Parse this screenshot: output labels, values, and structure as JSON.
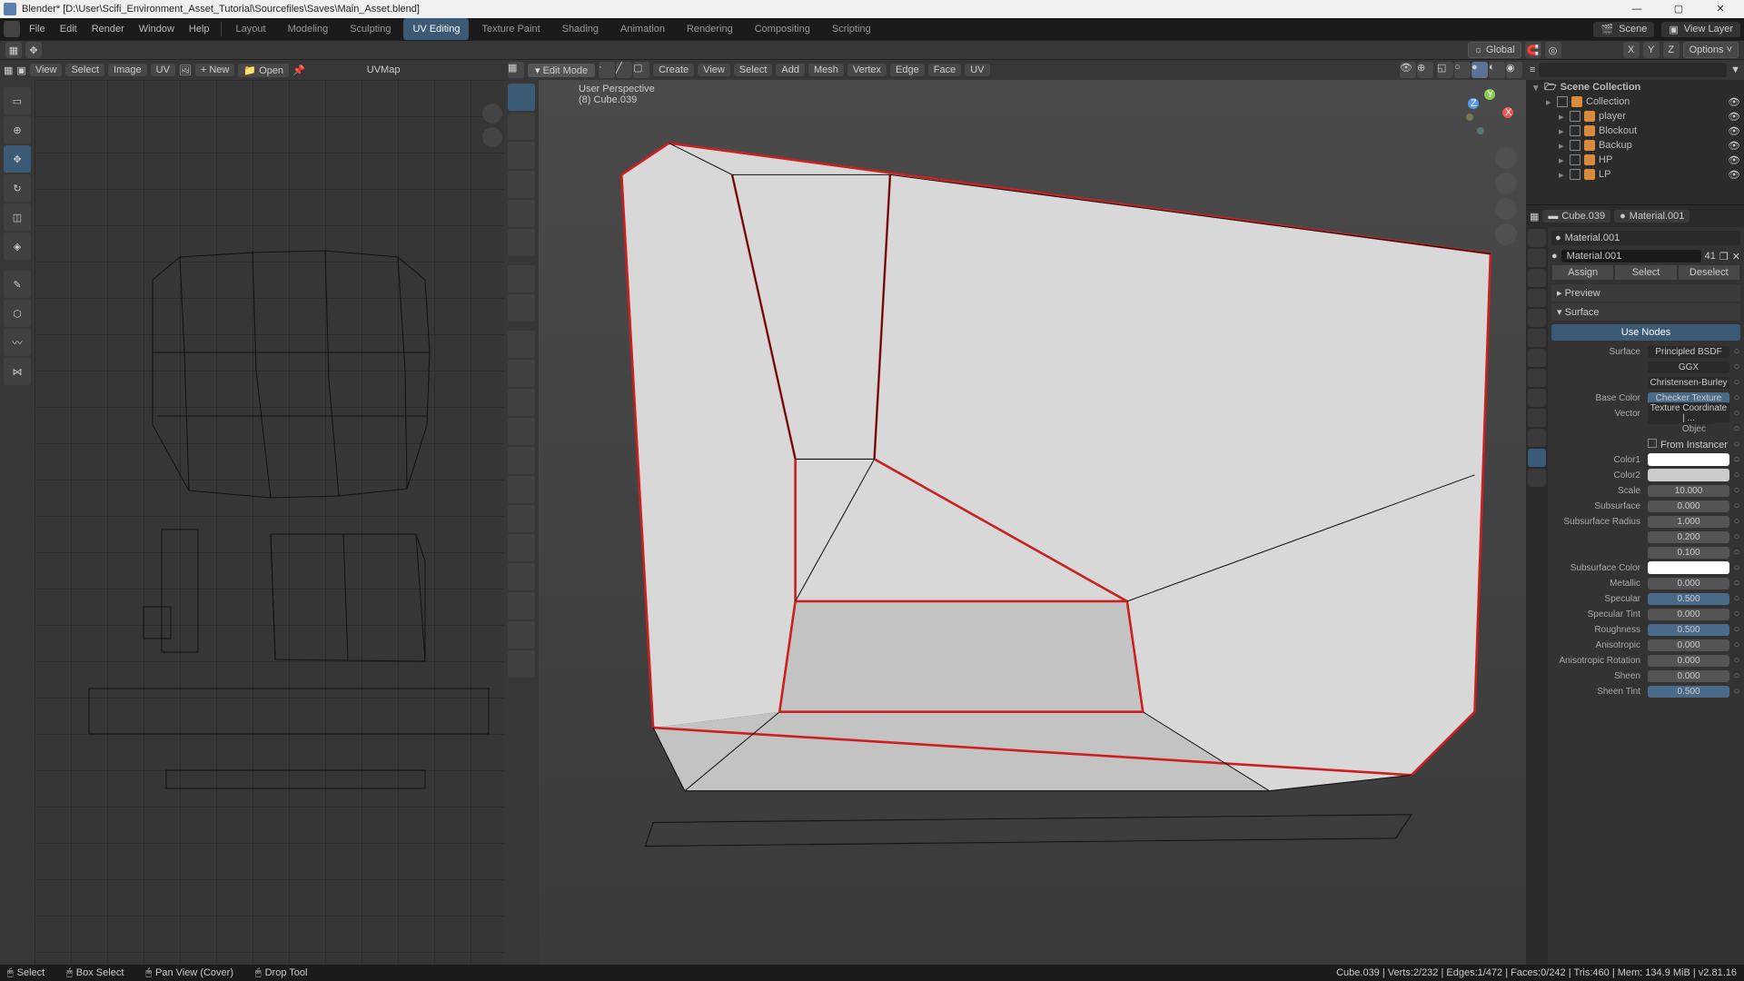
{
  "window": {
    "title": "Blender* [D:\\User\\Scifi_Environment_Asset_Tutorial\\Sourcefiles\\Saves\\Main_Asset.blend]"
  },
  "menu": {
    "items": [
      "File",
      "Edit",
      "Render",
      "Window",
      "Help"
    ]
  },
  "tabs": {
    "items": [
      "Layout",
      "Modeling",
      "Sculpting",
      "UV Editing",
      "Texture Paint",
      "Shading",
      "Animation",
      "Rendering",
      "Compositing",
      "Scripting"
    ],
    "active": 3
  },
  "scene": {
    "label": "Scene",
    "viewlayer": "View Layer"
  },
  "toolrow": {
    "global": "Global",
    "options": "Options ˅"
  },
  "uv": {
    "menus": [
      "View",
      "Select",
      "Image",
      "UV"
    ],
    "new": "New",
    "open": "Open",
    "map": "UVMap"
  },
  "viewport": {
    "mode": "Edit Mode",
    "menus": [
      "View",
      "Select",
      "Add",
      "Mesh",
      "Vertex",
      "Edge",
      "Face",
      "UV"
    ],
    "create_label": "Create",
    "info1": "User Perspective",
    "info2": "(8) Cube.039"
  },
  "outliner": {
    "root": "Scene Collection",
    "items": [
      {
        "name": "Collection",
        "depth": 1
      },
      {
        "name": "player",
        "depth": 2
      },
      {
        "name": "Blockout",
        "depth": 2
      },
      {
        "name": "Backup",
        "depth": 2
      },
      {
        "name": "HP",
        "depth": 2
      },
      {
        "name": "LP",
        "depth": 2
      }
    ]
  },
  "breadcrumb": {
    "obj": "Cube.039",
    "mat": "Material.001"
  },
  "material": {
    "slot": "Material.001",
    "name": "Material.001",
    "users": "41",
    "assign": "Assign",
    "select": "Select",
    "deselect": "Deselect",
    "preview": "Preview",
    "surface": "Surface",
    "usenodes": "Use Nodes",
    "props": [
      {
        "label": "Surface",
        "value": "Principled BSDF",
        "type": "ddl"
      },
      {
        "label": "",
        "value": "GGX",
        "type": "ddl"
      },
      {
        "label": "",
        "value": "Christensen-Burley",
        "type": "ddl"
      },
      {
        "label": "Base Color",
        "value": "Checker Texture",
        "type": "ddlblue"
      },
      {
        "label": "Vector",
        "value": "Texture Coordinate | ...",
        "type": "ddl"
      },
      {
        "label": "Objec",
        "value": "",
        "type": "swatchsmall"
      },
      {
        "label": "",
        "value": "From Instancer",
        "type": "check"
      },
      {
        "label": "Color1",
        "value": "",
        "type": "swatch"
      },
      {
        "label": "Color2",
        "value": "",
        "type": "swatch2"
      },
      {
        "label": "Scale",
        "value": "10.000",
        "type": "num"
      },
      {
        "label": "Subsurface",
        "value": "0.000",
        "type": "num"
      },
      {
        "label": "Subsurface Radius",
        "value": "1.000",
        "type": "num"
      },
      {
        "label": "",
        "value": "0.200",
        "type": "num"
      },
      {
        "label": "",
        "value": "0.100",
        "type": "num"
      },
      {
        "label": "Subsurface Color",
        "value": "",
        "type": "swatch"
      },
      {
        "label": "Metallic",
        "value": "0.000",
        "type": "num"
      },
      {
        "label": "Specular",
        "value": "0.500",
        "type": "numblue"
      },
      {
        "label": "Specular Tint",
        "value": "0.000",
        "type": "num"
      },
      {
        "label": "Roughness",
        "value": "0.500",
        "type": "numblue"
      },
      {
        "label": "Anisotropic",
        "value": "0.000",
        "type": "num"
      },
      {
        "label": "Anisotropic Rotation",
        "value": "0.000",
        "type": "num"
      },
      {
        "label": "Sheen",
        "value": "0.000",
        "type": "num"
      },
      {
        "label": "Sheen Tint",
        "value": "0.500",
        "type": "numblue"
      }
    ]
  },
  "status": {
    "select": "Select",
    "boxselect": "Box Select",
    "pan": "Pan View (Cover)",
    "drop": "Drop Tool",
    "right": "Cube.039 | Verts:2/232 | Edges:1/472 | Faces:0/242 | Tris:460 | Mem: 134.9 MiB | v2.81.16"
  }
}
